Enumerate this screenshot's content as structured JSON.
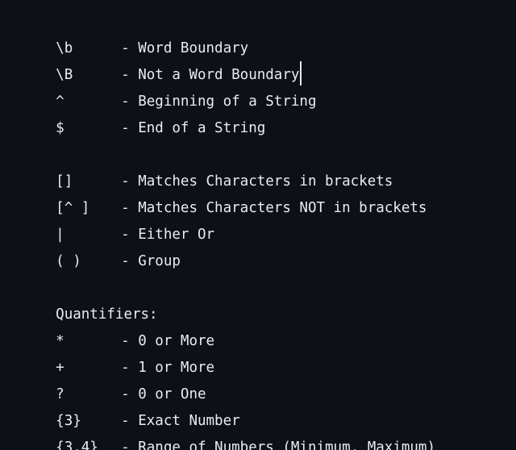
{
  "editor": {
    "background": "#0d1117",
    "text_color": "#e6edf3",
    "anchors": [
      {
        "symbol": "\\b",
        "description": "- Word Boundary"
      },
      {
        "symbol": "\\B",
        "description": "- Not a Word Boundary"
      },
      {
        "symbol": "^",
        "description": "- Beginning of a String"
      },
      {
        "symbol": "$",
        "description": "- End of a String"
      }
    ],
    "groups": [
      {
        "symbol": "[]",
        "description": "- Matches Characters in brackets"
      },
      {
        "symbol": "[^ ]",
        "description": "- Matches Characters NOT in brackets"
      },
      {
        "symbol": "|",
        "description": "- Either Or"
      },
      {
        "symbol": "( )",
        "description": "- Group"
      }
    ],
    "quantifiers_heading": "Quantifiers:",
    "quantifiers": [
      {
        "symbol": "*",
        "description": "- 0 or More"
      },
      {
        "symbol": "+",
        "description": "- 1 or More"
      },
      {
        "symbol": "?",
        "description": "- 0 or One"
      },
      {
        "symbol": "{3}",
        "description": "- Exact Number"
      },
      {
        "symbol": "{3,4}",
        "description": "- Range of Numbers (Minimum, Maximum)"
      }
    ]
  }
}
